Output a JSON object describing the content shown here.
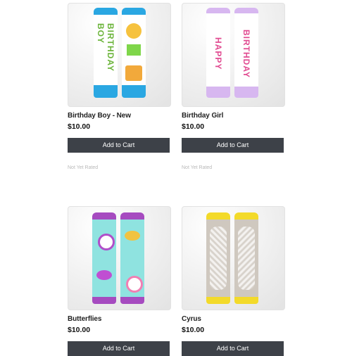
{
  "products": [
    {
      "name": "Birthday Boy - New",
      "price": "$10.00",
      "button": "Add to Cart",
      "rating": "Not Yet Rated",
      "left_text": "BIRTHDAY BOY"
    },
    {
      "name": "Birthday Girl",
      "price": "$10.00",
      "button": "Add to Cart",
      "rating": "Not Yet Rated",
      "left_text": "HAPPY",
      "right_text": "BIRTHDAY"
    },
    {
      "name": "Butterflies",
      "price": "$10.00",
      "button": "Add to Cart"
    },
    {
      "name": "Cyrus",
      "price": "$10.00",
      "button": "Add to Cart"
    }
  ],
  "colors": {
    "button_bg": "#3d4148",
    "button_text": "#ffffff",
    "rating_text": "#b9b9b9"
  }
}
